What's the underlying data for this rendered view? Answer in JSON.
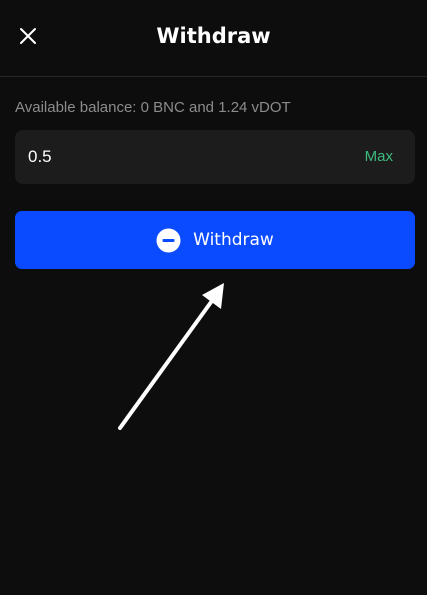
{
  "header": {
    "title": "Withdraw",
    "close_icon": "close-icon"
  },
  "balance": {
    "text": "Available balance: 0 BNC and 1.24 vDOT"
  },
  "amount": {
    "value": "0.5",
    "max_label": "Max"
  },
  "action": {
    "withdraw_label": "Withdraw",
    "icon": "minus-circle-icon"
  },
  "colors": {
    "background": "#0d0d0d",
    "accent": "#0a4bff",
    "max": "#3dba7e",
    "input_bg": "#1c1c1c"
  }
}
